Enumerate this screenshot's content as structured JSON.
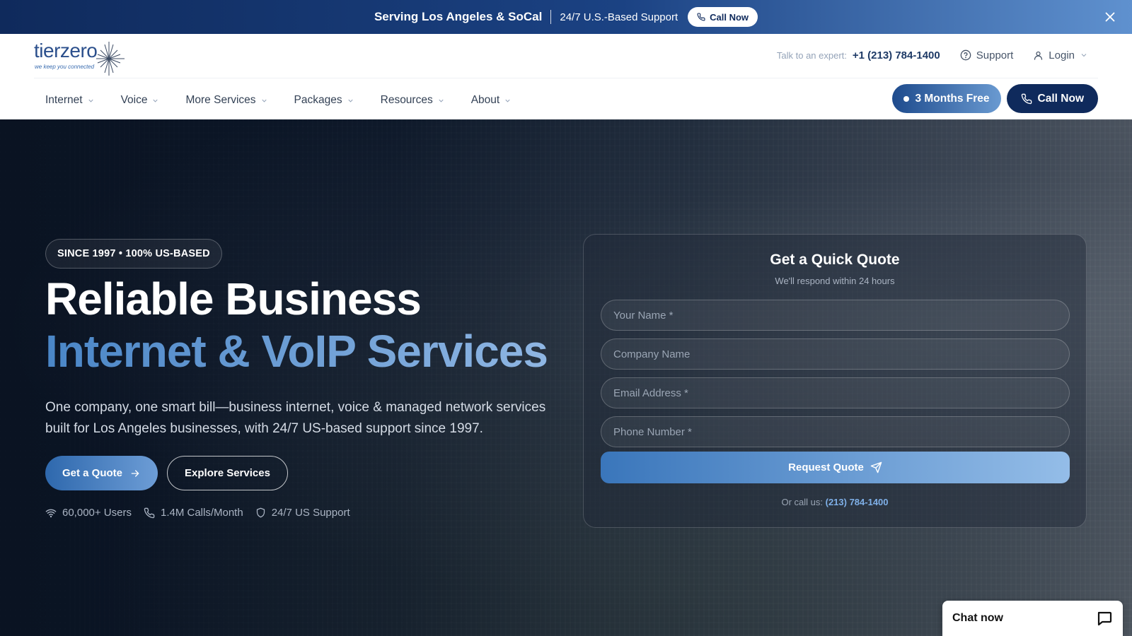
{
  "announcement": {
    "region": "Serving Los Angeles & SoCal",
    "support": "24/7 U.S.-Based Support",
    "call_label": "Call Now"
  },
  "header": {
    "logo_word": "tierzero",
    "logo_tagline": "we keep you connected",
    "talk_label": "Talk to an expert:",
    "phone": "+1 (213) 784-1400",
    "support_label": "Support",
    "login_label": "Login",
    "nav": [
      "Internet",
      "Voice",
      "More Services",
      "Packages",
      "Resources",
      "About"
    ],
    "promo_label": "3 Months Free",
    "call_label": "Call Now"
  },
  "hero": {
    "badge": "SINCE 1997 • 100% US-BASED",
    "headline_1": "Reliable Business",
    "headline_2": "Internet & VoIP Services",
    "description": "One company, one smart bill—business internet, voice & managed network services built for Los Angeles businesses, with 24/7 US-based support since 1997.",
    "quote_button": "Get a Quote",
    "explore_button": "Explore Services",
    "stats": [
      "60,000+ Users",
      "1.4M Calls/Month",
      "24/7 US Support"
    ]
  },
  "quote_form": {
    "title": "Get a Quick Quote",
    "subtitle": "We'll respond within 24 hours",
    "name_placeholder": "Your Name *",
    "company_placeholder": "Company Name",
    "email_placeholder": "Email Address *",
    "phone_placeholder": "Phone Number *",
    "submit_label": "Request Quote",
    "or_call_label": "Or call us:",
    "or_call_number": "(213) 784-1400"
  },
  "chat": {
    "label": "Chat now"
  },
  "colors": {
    "navy": "#0f2a5c",
    "accent_blue": "#4a86c7",
    "light_blue": "#8fb6e3"
  }
}
